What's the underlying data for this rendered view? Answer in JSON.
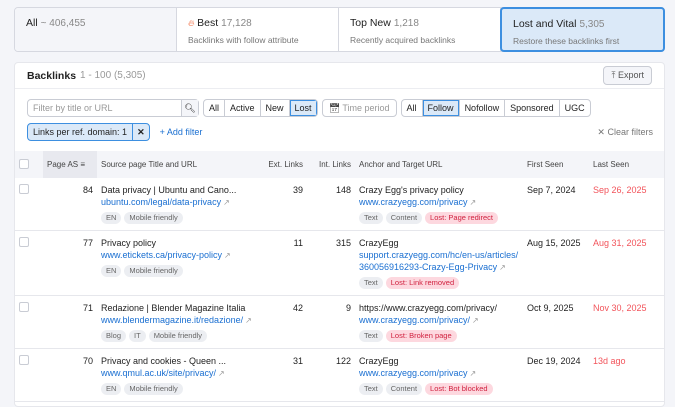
{
  "cards": [
    {
      "title": "All",
      "count": "~ 406,455",
      "subtitle": ""
    },
    {
      "title": "Best",
      "count": "17,128",
      "subtitle": "Backlinks with follow attribute",
      "icon": "fire-icon"
    },
    {
      "title": "Top New",
      "count": "1,218",
      "subtitle": "Recently acquired backlinks"
    },
    {
      "title": "Lost and Vital",
      "count": "5,305",
      "subtitle": "Restore these backlinks first"
    }
  ],
  "panel": {
    "title": "Backlinks",
    "range": "1 - 100 (5,305)",
    "export": "Export"
  },
  "filters": {
    "search_placeholder": "Filter by title or URL",
    "status": [
      "All",
      "Active",
      "New",
      "Lost"
    ],
    "time_period": "Time period",
    "type": [
      "All",
      "Follow",
      "Nofollow",
      "Sponsored",
      "UGC"
    ],
    "chip": "Links per ref. domain: 1",
    "add_filter": "Add filter",
    "clear_filters": "Clear filters"
  },
  "columns": [
    "Page AS",
    "Source page Title and URL",
    "Ext. Links",
    "Int. Links",
    "Anchor and Target URL",
    "First Seen",
    "Last Seen"
  ],
  "rows": [
    {
      "as": "84",
      "title": "Data privacy | Ubuntu and Cano...",
      "url": "ubuntu.com/legal/data-privacy",
      "stags": [
        "EN",
        "Mobile friendly"
      ],
      "ext": "39",
      "int": "148",
      "anchor": "Crazy Egg's privacy policy",
      "target": "www.crazyegg.com/privacy",
      "atags": [
        "Text",
        "Content"
      ],
      "lost": "Lost: Page redirect",
      "first": "Sep 7, 2024",
      "last": "Sep 26, 2025"
    },
    {
      "as": "77",
      "title": "Privacy policy",
      "url": "www.etickets.ca/privacy-policy",
      "stags": [
        "EN",
        "Mobile friendly"
      ],
      "ext": "11",
      "int": "315",
      "anchor": "CrazyEgg",
      "target": "support.crazyegg.com/hc/en-us/articles/360056916293-Crazy-Egg-Privacy",
      "atags": [
        "Text"
      ],
      "lost": "Lost: Link removed",
      "first": "Aug 15, 2025",
      "last": "Aug 31, 2025"
    },
    {
      "as": "71",
      "title": "Redazione | Blender Magazine Italia",
      "url": "www.blendermagazine.it/redazione/",
      "stags": [
        "Blog",
        "IT",
        "Mobile friendly"
      ],
      "ext": "42",
      "int": "9",
      "anchor": "https://www.crazyegg.com/privacy/",
      "target": "www.crazyegg.com/privacy/",
      "atags": [
        "Text"
      ],
      "lost": "Lost: Broken page",
      "first": "Oct 9, 2025",
      "last": "Nov 30, 2025"
    },
    {
      "as": "70",
      "title": "Privacy and cookies - Queen ...",
      "url": "www.qmul.ac.uk/site/privacy/",
      "stags": [
        "EN",
        "Mobile friendly"
      ],
      "ext": "31",
      "int": "122",
      "anchor": "CrazyEgg",
      "target": "www.crazyegg.com/privacy",
      "atags": [
        "Text",
        "Content"
      ],
      "lost": "Lost: Bot blocked",
      "first": "Dec 19, 2024",
      "last": "13d ago"
    }
  ]
}
